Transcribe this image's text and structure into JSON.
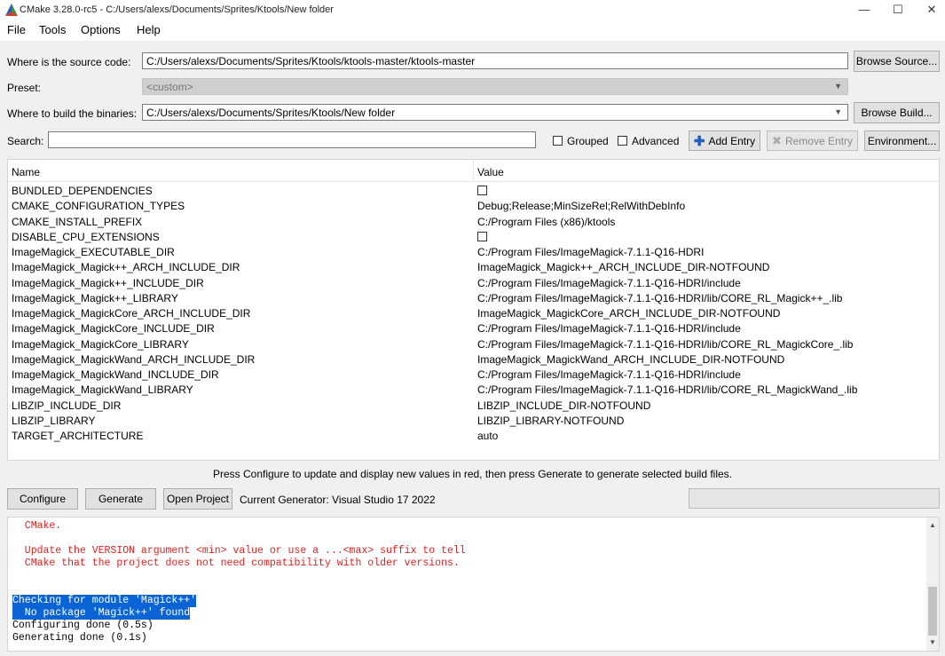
{
  "window": {
    "title": "CMake 3.28.0-rc5 - C:/Users/alexs/Documents/Sprites/Ktools/New folder",
    "minimize": "—",
    "maximize": "☐",
    "close": "✕"
  },
  "menu": [
    "File",
    "Tools",
    "Options",
    "Help"
  ],
  "source": {
    "label": "Where is the source code:",
    "value": "C:/Users/alexs/Documents/Sprites/Ktools/ktools-master/ktools-master",
    "button": "Browse Source..."
  },
  "preset": {
    "label": "Preset:",
    "value": "<custom>"
  },
  "build": {
    "label": "Where to build the binaries:",
    "value": "C:/Users/alexs/Documents/Sprites/Ktools/New folder",
    "button": "Browse Build..."
  },
  "search": {
    "label": "Search:",
    "value": "",
    "grouped": "Grouped",
    "advanced": "Advanced",
    "add_entry": "Add Entry",
    "remove_entry": "Remove Entry",
    "environment": "Environment..."
  },
  "table": {
    "headers": [
      "Name",
      "Value"
    ],
    "rows": [
      {
        "name": "BUNDLED_DEPENDENCIES",
        "value": "",
        "checkbox": true
      },
      {
        "name": "CMAKE_CONFIGURATION_TYPES",
        "value": "Debug;Release;MinSizeRel;RelWithDebInfo"
      },
      {
        "name": "CMAKE_INSTALL_PREFIX",
        "value": "C:/Program Files (x86)/ktools"
      },
      {
        "name": "DISABLE_CPU_EXTENSIONS",
        "value": "",
        "checkbox": true
      },
      {
        "name": "ImageMagick_EXECUTABLE_DIR",
        "value": "C:/Program Files/ImageMagick-7.1.1-Q16-HDRI"
      },
      {
        "name": "ImageMagick_Magick++_ARCH_INCLUDE_DIR",
        "value": "ImageMagick_Magick++_ARCH_INCLUDE_DIR-NOTFOUND"
      },
      {
        "name": "ImageMagick_Magick++_INCLUDE_DIR",
        "value": "C:/Program Files/ImageMagick-7.1.1-Q16-HDRI/include"
      },
      {
        "name": "ImageMagick_Magick++_LIBRARY",
        "value": "C:/Program Files/ImageMagick-7.1.1-Q16-HDRI/lib/CORE_RL_Magick++_.lib"
      },
      {
        "name": "ImageMagick_MagickCore_ARCH_INCLUDE_DIR",
        "value": "ImageMagick_MagickCore_ARCH_INCLUDE_DIR-NOTFOUND"
      },
      {
        "name": "ImageMagick_MagickCore_INCLUDE_DIR",
        "value": "C:/Program Files/ImageMagick-7.1.1-Q16-HDRI/include"
      },
      {
        "name": "ImageMagick_MagickCore_LIBRARY",
        "value": "C:/Program Files/ImageMagick-7.1.1-Q16-HDRI/lib/CORE_RL_MagickCore_.lib"
      },
      {
        "name": "ImageMagick_MagickWand_ARCH_INCLUDE_DIR",
        "value": "ImageMagick_MagickWand_ARCH_INCLUDE_DIR-NOTFOUND"
      },
      {
        "name": "ImageMagick_MagickWand_INCLUDE_DIR",
        "value": "C:/Program Files/ImageMagick-7.1.1-Q16-HDRI/include"
      },
      {
        "name": "ImageMagick_MagickWand_LIBRARY",
        "value": "C:/Program Files/ImageMagick-7.1.1-Q16-HDRI/lib/CORE_RL_MagickWand_.lib"
      },
      {
        "name": "LIBZIP_INCLUDE_DIR",
        "value": "LIBZIP_INCLUDE_DIR-NOTFOUND"
      },
      {
        "name": "LIBZIP_LIBRARY",
        "value": "LIBZIP_LIBRARY-NOTFOUND"
      },
      {
        "name": "TARGET_ARCHITECTURE",
        "value": "auto"
      }
    ]
  },
  "hint": "Press Configure to update and display new values in red, then press Generate to generate selected build files.",
  "actions": {
    "configure": "Configure",
    "generate": "Generate",
    "open_project": "Open Project",
    "generator": "Current Generator: Visual Studio 17 2022"
  },
  "log": [
    {
      "text": "  CMake.",
      "style": "red"
    },
    {
      "text": "  Update the VERSION argument <min> value or use a ...<max> suffix to tell",
      "style": "red"
    },
    {
      "text": "  CMake that the project does not need compatibility with older versions.",
      "style": "red"
    },
    {
      "text": "Checking for module 'Magick++'",
      "style": "selected"
    },
    {
      "text": "  No package 'Magick++' found",
      "style": "selected"
    },
    {
      "text": "Configuring done (0.5s)",
      "style": "normal"
    },
    {
      "text": "Generating done (0.1s)",
      "style": "normal"
    }
  ],
  "colors": {
    "log_error": "#e32020",
    "selection": "#0a64d6",
    "window_bg": "#f0f0f0"
  }
}
